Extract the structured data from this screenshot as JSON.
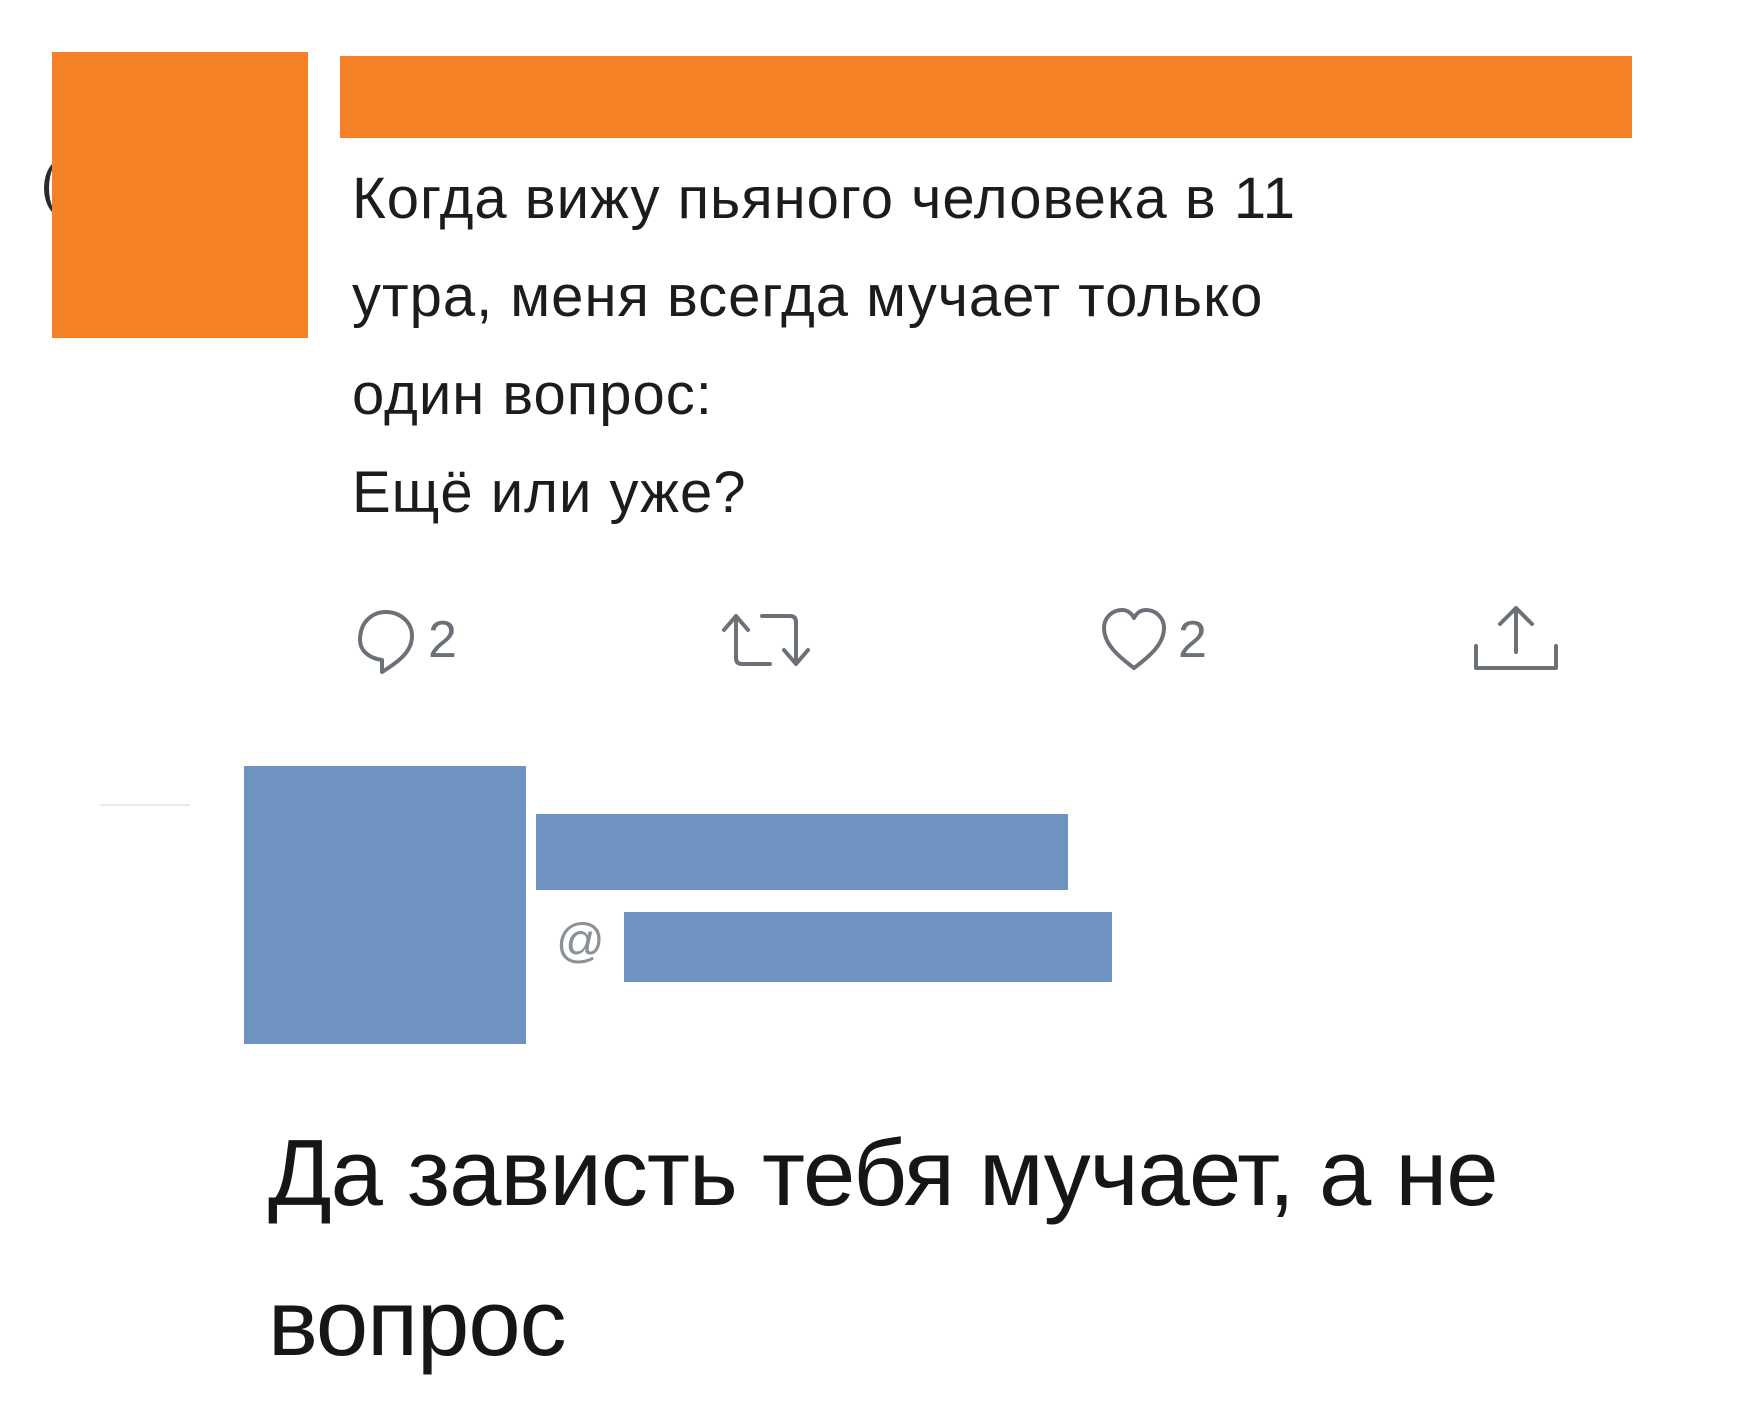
{
  "tweet": {
    "text": "Когда вижу пьяного человека в 11\nутра, меня всегда мучает только\nодин вопрос:\nЕщё или уже?",
    "actions": {
      "reply_count": "2",
      "like_count": "2"
    },
    "redaction_color": "#f58025"
  },
  "reply": {
    "handle_prefix": "@",
    "text": "Да зависть тебя мучает, а не\nвопрос",
    "redaction_color": "#6f93c0"
  },
  "icons": [
    "reply-icon",
    "retweet-icon",
    "like-icon",
    "share-icon"
  ]
}
